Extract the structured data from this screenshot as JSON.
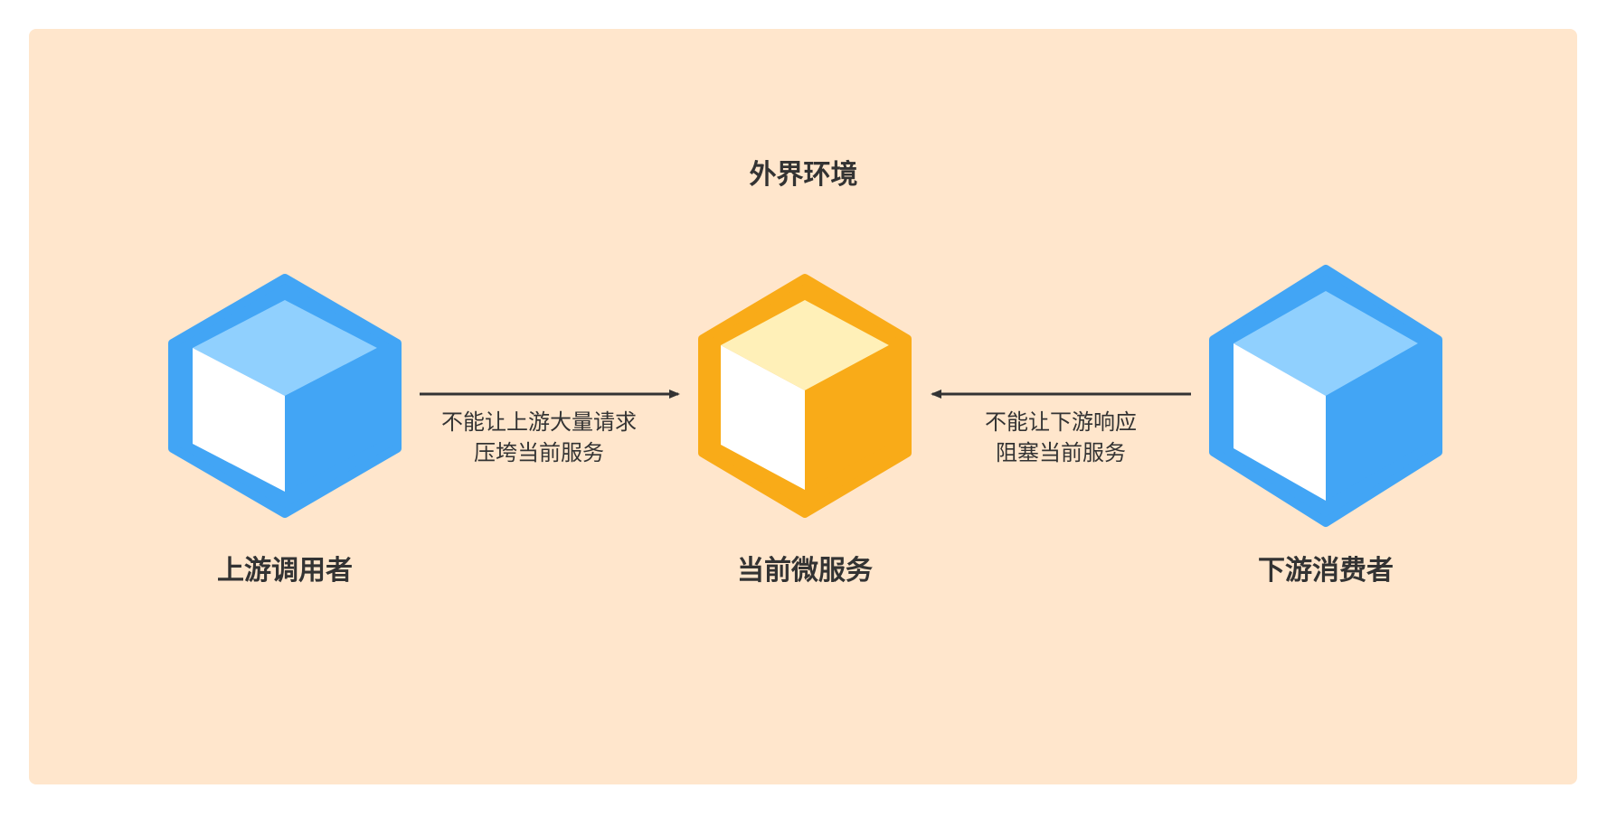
{
  "environment": {
    "title": "外界环境",
    "background_color": "#ffe6cc"
  },
  "nodes": {
    "upstream": {
      "label": "上游调用者",
      "icon": "cube-icon",
      "colors": {
        "frame": "#42a5f5",
        "top": "#90d0fe",
        "side": "#42a5f5",
        "front": "#ffffff"
      }
    },
    "current": {
      "label": "当前微服务",
      "icon": "cube-icon",
      "colors": {
        "frame": "#f9ab18",
        "top": "#fff0b8",
        "side": "#f9ab18",
        "front": "#ffffff"
      }
    },
    "downstream": {
      "label": "下游消费者",
      "icon": "cube-icon",
      "colors": {
        "frame": "#42a5f5",
        "top": "#90d0fe",
        "side": "#42a5f5",
        "front": "#ffffff"
      }
    }
  },
  "edges": {
    "upstream_to_current": {
      "line1": "不能让上游大量请求",
      "line2": "压垮当前服务",
      "arrow_color": "#333333"
    },
    "downstream_to_current": {
      "line1": "不能让下游响应",
      "line2": "阻塞当前服务",
      "arrow_color": "#333333"
    }
  }
}
